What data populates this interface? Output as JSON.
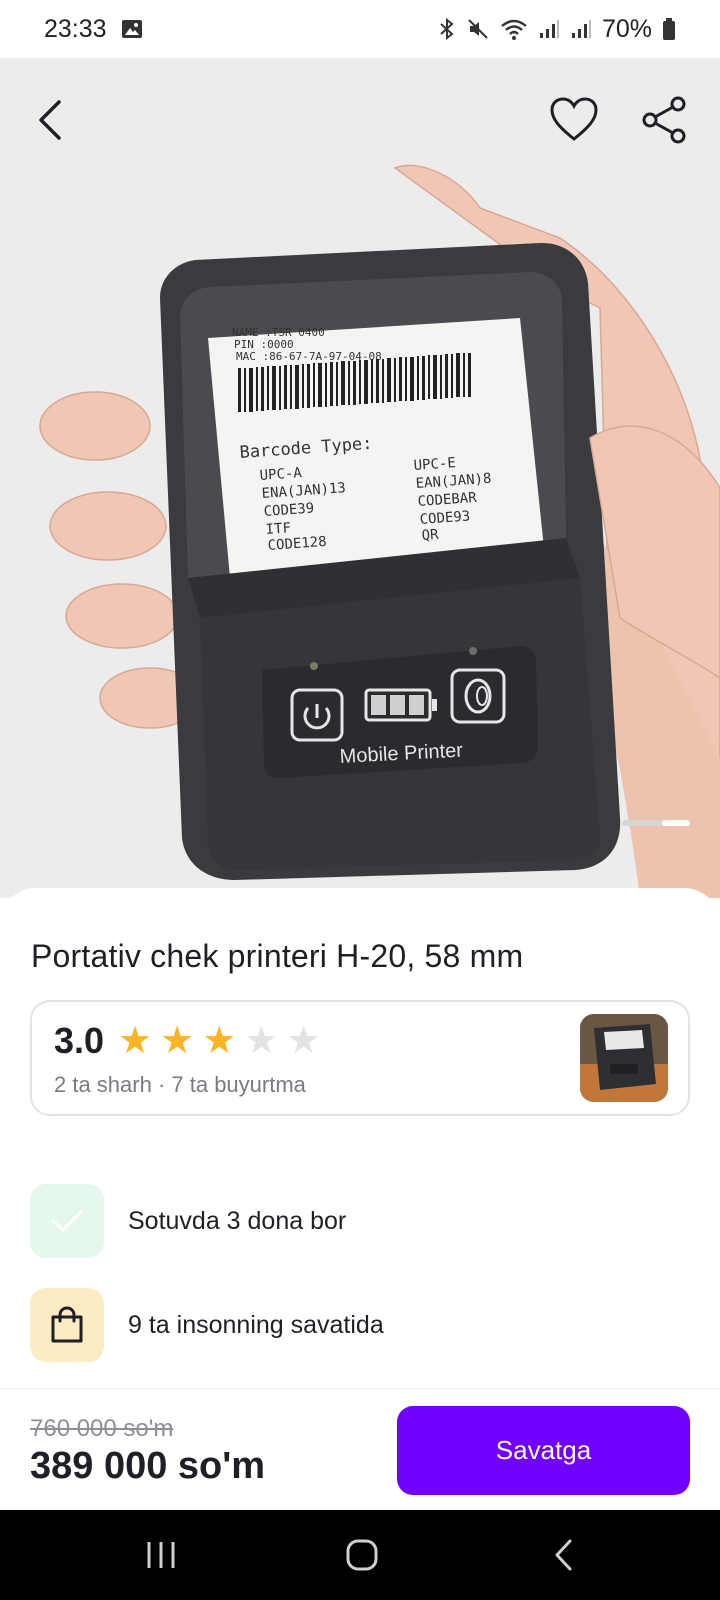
{
  "status_bar": {
    "time": "23:33",
    "battery": "70%",
    "icons": [
      "gallery-icon",
      "bluetooth-icon",
      "mute-icon",
      "wifi-icon",
      "signal-icon",
      "signal-icon",
      "battery-icon"
    ]
  },
  "hero": {
    "image_description": "mobile-printer-photo",
    "paper_text": {
      "header_lines": [
        "NAME  :TSR 0400",
        "PIN   :0000",
        "MAC   :86-67-7A-97-04-08"
      ],
      "barcode_type": "Barcode Type:",
      "left_col": [
        "UPC-A",
        "ENA(JAN)13",
        "CODE39",
        "ITF",
        "CODE128"
      ],
      "right_col": [
        "UPC-E",
        "EAN(JAN)8",
        "CODEBAR",
        "CODE93",
        "QR"
      ]
    },
    "printer_label": "Mobile Printer",
    "icons": [
      "back-arrow-icon",
      "heart-icon",
      "share-icon"
    ]
  },
  "product": {
    "title": "Portativ chek printeri H-20, 58 mm",
    "rating": {
      "value": "3.0",
      "stars_filled": 3,
      "stars_total": 5,
      "meta": "2 ta sharh · 7 ta buyurtma"
    },
    "info": [
      {
        "text": "Sotuvda 3 dona bor",
        "icon": "check-icon"
      },
      {
        "text": "9 ta insonning savatida",
        "icon": "shopping-bag-icon"
      }
    ]
  },
  "purchase": {
    "old_price": "760 000 so'm",
    "new_price": "389 000 so'm",
    "cart_label": "Savatga"
  },
  "colors": {
    "accent": "#7000ff",
    "star": "#fbb524",
    "star_empty": "#e3e3e6",
    "green_badge": "#e6f7ec",
    "yellow_badge": "#fdebc4"
  }
}
